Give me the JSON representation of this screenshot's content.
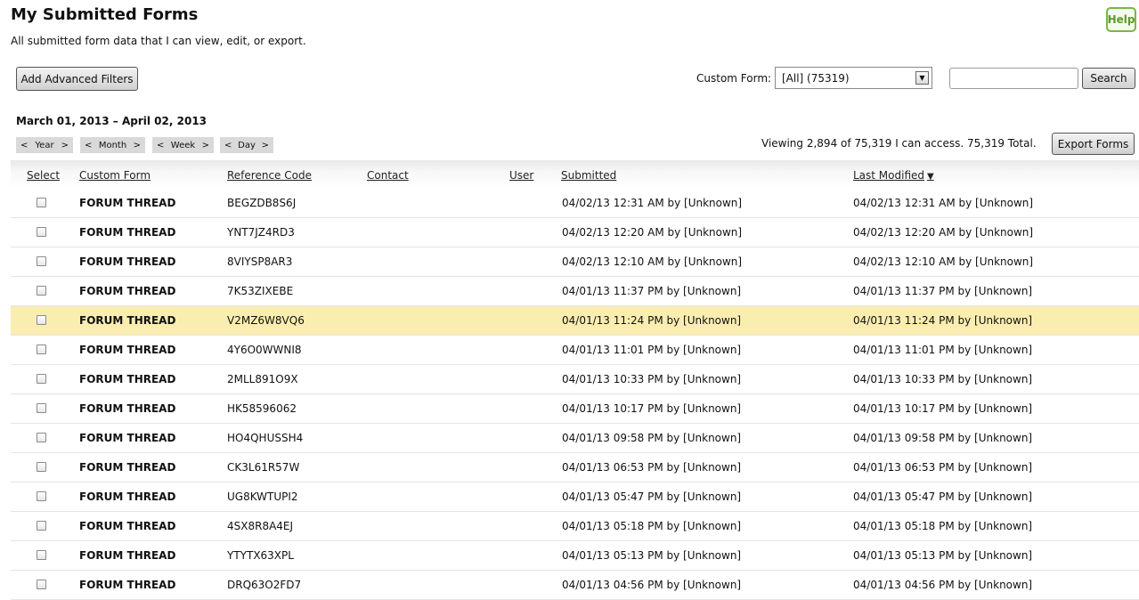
{
  "page": {
    "title": "My Submitted Forms",
    "subtitle": "All submitted form data that I can view, edit, or export.",
    "help_label": "Help"
  },
  "toolbar": {
    "advanced_filters_label": "Add Advanced Filters",
    "custom_form_label": "Custom Form:",
    "custom_form_value": "[All] (75319)",
    "search_value": "",
    "search_label": "Search"
  },
  "date_nav": {
    "range": "March 01, 2013 – April 02, 2013",
    "prev_symbol": "<",
    "next_symbol": ">",
    "year_label": "Year",
    "month_label": "Month",
    "week_label": "Week",
    "day_label": "Day"
  },
  "summary": {
    "viewing_text": "Viewing 2,894 of 75,319 I can access. 75,319 Total.",
    "export_label": "Export Forms"
  },
  "table": {
    "columns": {
      "select": "Select",
      "custom_form": "Custom Form",
      "reference_code": "Reference Code",
      "contact": "Contact",
      "user": "User",
      "submitted": "Submitted",
      "last_modified": "Last Modified",
      "sort_indicator": "▼"
    },
    "rows": [
      {
        "form": "FORUM THREAD",
        "ref": "BEGZDB8S6J",
        "submitted": "04/02/13 12:31 AM by [Unknown]",
        "modified": "04/02/13 12:31 AM by [Unknown]"
      },
      {
        "form": "FORUM THREAD",
        "ref": "YNT7JZ4RD3",
        "submitted": "04/02/13 12:20 AM by [Unknown]",
        "modified": "04/02/13 12:20 AM by [Unknown]"
      },
      {
        "form": "FORUM THREAD",
        "ref": "8VIYSP8AR3",
        "submitted": "04/02/13 12:10 AM by [Unknown]",
        "modified": "04/02/13 12:10 AM by [Unknown]"
      },
      {
        "form": "FORUM THREAD",
        "ref": "7K53ZIXEBE",
        "submitted": "04/01/13 11:37 PM by [Unknown]",
        "modified": "04/01/13 11:37 PM by [Unknown]"
      },
      {
        "form": "FORUM THREAD",
        "ref": "V2MZ6W8VQ6",
        "submitted": "04/01/13 11:24 PM by [Unknown]",
        "modified": "04/01/13 11:24 PM by [Unknown]"
      },
      {
        "form": "FORUM THREAD",
        "ref": "4Y6O0WWNI8",
        "submitted": "04/01/13 11:01 PM by [Unknown]",
        "modified": "04/01/13 11:01 PM by [Unknown]"
      },
      {
        "form": "FORUM THREAD",
        "ref": "2MLL891O9X",
        "submitted": "04/01/13 10:33 PM by [Unknown]",
        "modified": "04/01/13 10:33 PM by [Unknown]"
      },
      {
        "form": "FORUM THREAD",
        "ref": "HK58596062",
        "submitted": "04/01/13 10:17 PM by [Unknown]",
        "modified": "04/01/13 10:17 PM by [Unknown]"
      },
      {
        "form": "FORUM THREAD",
        "ref": "HO4QHUSSH4",
        "submitted": "04/01/13 09:58 PM by [Unknown]",
        "modified": "04/01/13 09:58 PM by [Unknown]"
      },
      {
        "form": "FORUM THREAD",
        "ref": "CK3L61R57W",
        "submitted": "04/01/13 06:53 PM by [Unknown]",
        "modified": "04/01/13 06:53 PM by [Unknown]"
      },
      {
        "form": "FORUM THREAD",
        "ref": "UG8KWTUPI2",
        "submitted": "04/01/13 05:47 PM by [Unknown]",
        "modified": "04/01/13 05:47 PM by [Unknown]"
      },
      {
        "form": "FORUM THREAD",
        "ref": "4SX8R8A4EJ",
        "submitted": "04/01/13 05:18 PM by [Unknown]",
        "modified": "04/01/13 05:18 PM by [Unknown]"
      },
      {
        "form": "FORUM THREAD",
        "ref": "YTYTX63XPL",
        "submitted": "04/01/13 05:13 PM by [Unknown]",
        "modified": "04/01/13 05:13 PM by [Unknown]"
      },
      {
        "form": "FORUM THREAD",
        "ref": "DRQ63O2FD7",
        "submitted": "04/01/13 04:56 PM by [Unknown]",
        "modified": "04/01/13 04:56 PM by [Unknown]"
      }
    ],
    "highlight_color": "#faedb0"
  }
}
